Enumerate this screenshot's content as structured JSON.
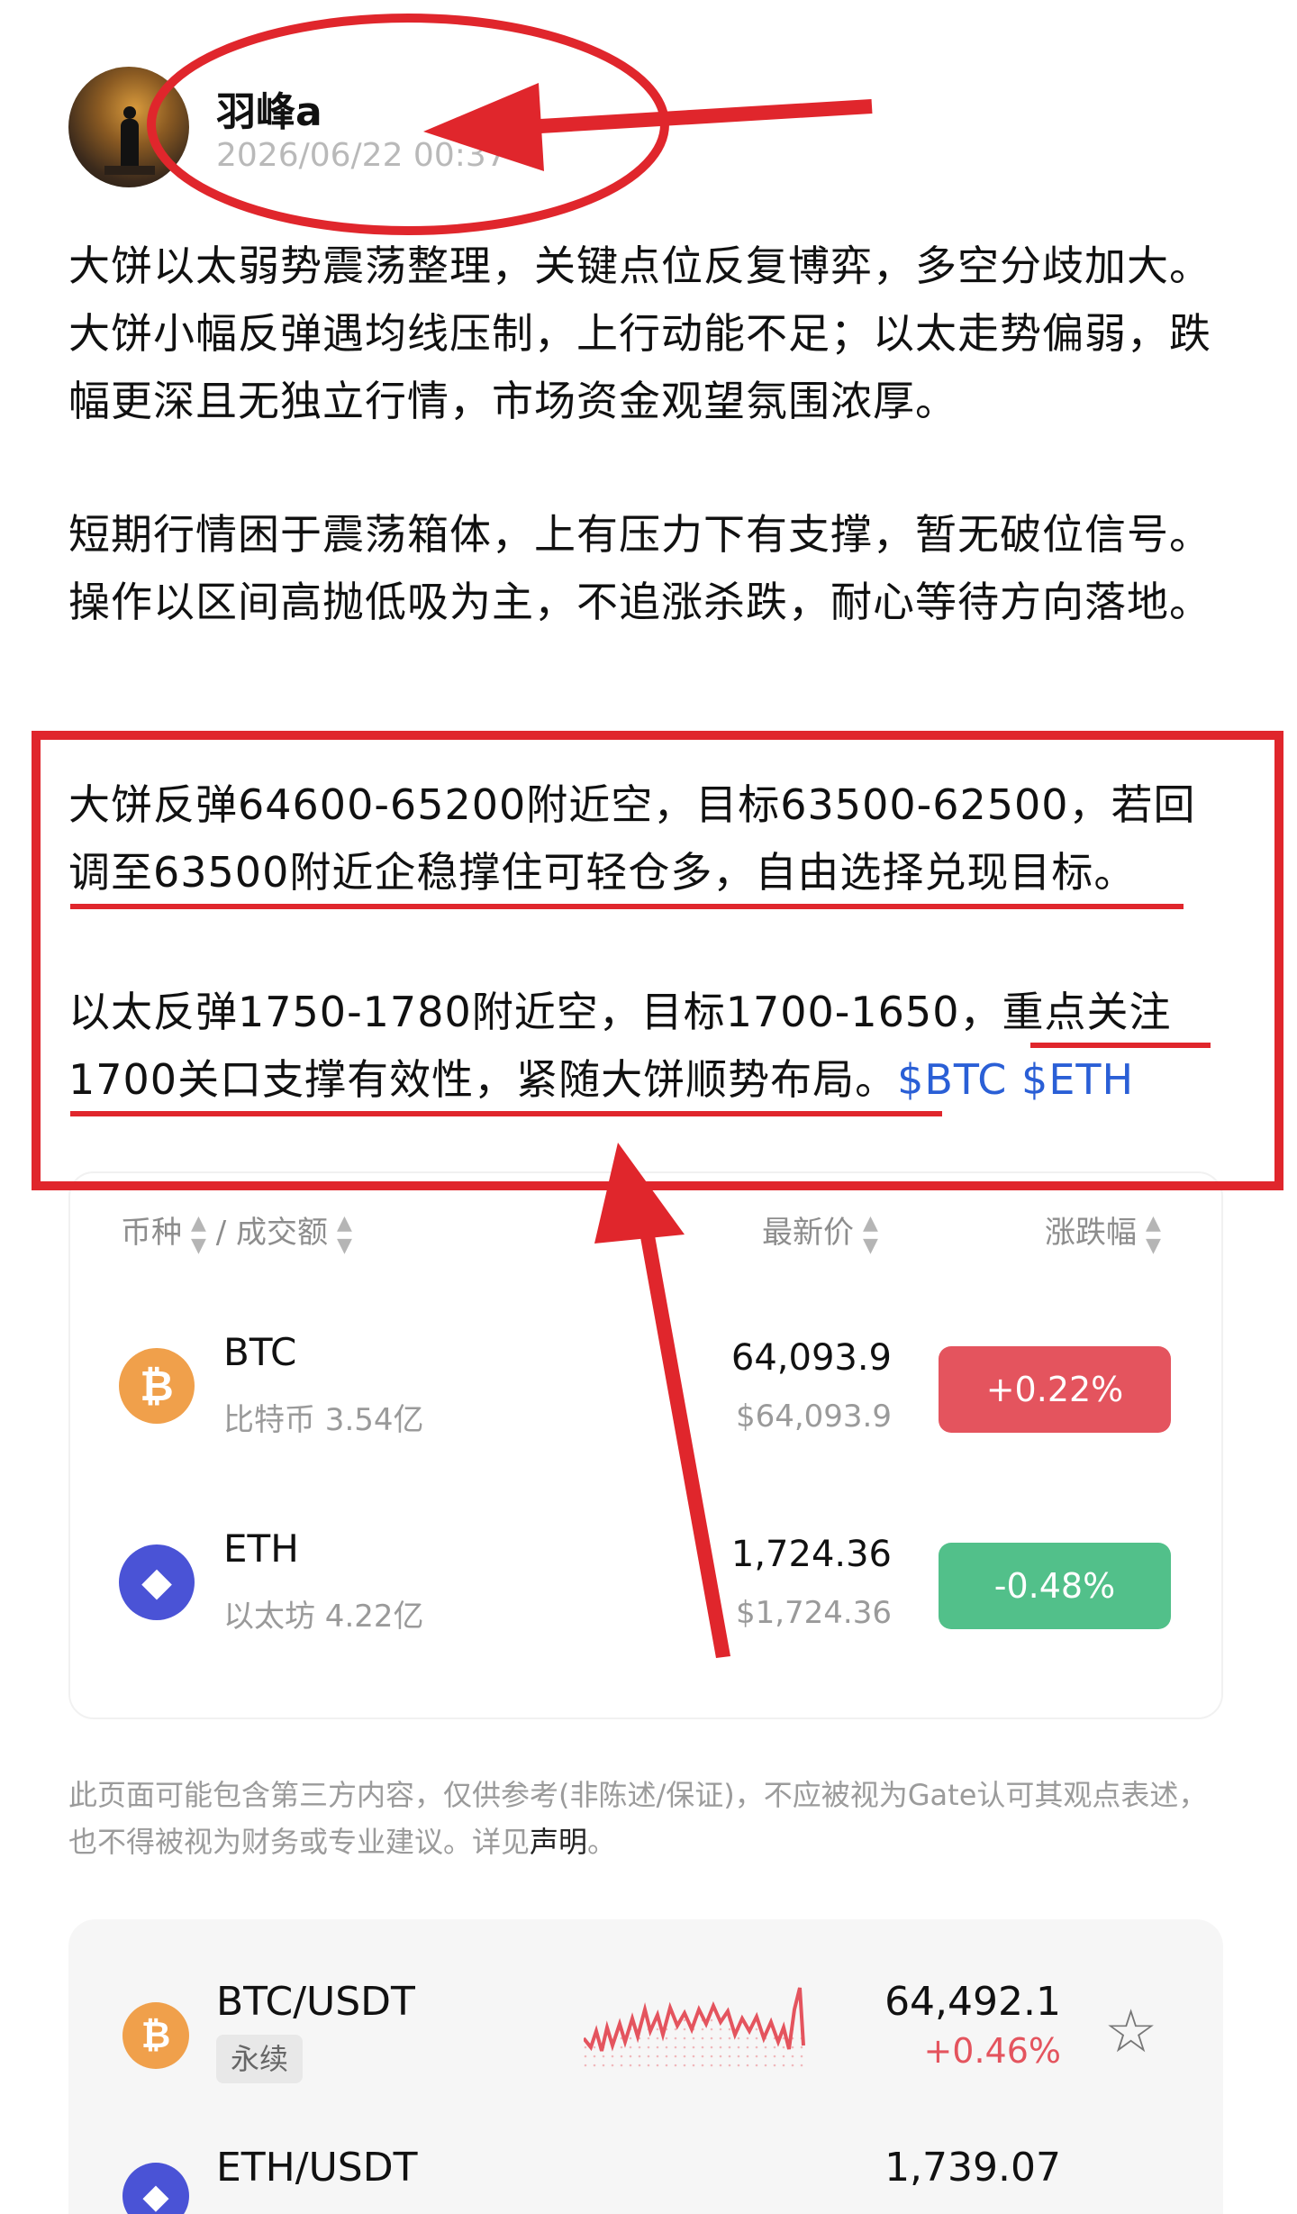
{
  "post": {
    "username": "羽峰a",
    "timestamp": "2026/06/22 00:37",
    "paragraph1": "大饼以太弱势震荡整理，关键点位反复博弈，多空分歧加大。大饼小幅反弹遇均线压制，上行动能不足；以太走势偏弱，跌幅更深且无独立行情，市场资金观望氛围浓厚。",
    "paragraph2": "短期行情困于震荡箱体，上有压力下有支撑，暂无破位信号。操作以区间高抛低吸为主，不追涨杀跌，耐心等待方向落地。",
    "paragraph3": "大饼反弹64600-65200附近空，目标63500-62500，若回调至63500附近企稳撑住可轻仓多，自由选择兑现目标。",
    "paragraph4": "以太反弹1750-1780附近空，目标1700-1650，重点关注1700关口支撑有效性，紧随大饼顺势布局。",
    "tags": "$BTC $ETH"
  },
  "market_table": {
    "header_coin": "币种",
    "header_sep": "/",
    "header_volume": "成交额",
    "header_price": "最新价",
    "header_change": "涨跌幅",
    "rows": [
      {
        "icon": "btc-icon",
        "glyph": "₿",
        "symbol": "BTC",
        "sub": "比特币 3.54亿",
        "price": "64,093.9",
        "price_usd": "$64,093.9",
        "change": "+0.22%",
        "color": "#e4545e"
      },
      {
        "icon": "eth-icon",
        "glyph": "◆",
        "symbol": "ETH",
        "sub": "以太坊 4.22亿",
        "price": "1,724.36",
        "price_usd": "$1,724.36",
        "change": "-0.48%",
        "color": "#52c08a"
      }
    ]
  },
  "disclaimer": {
    "text": "此页面可能包含第三方内容，仅供参考(非陈述/保证)，不应被视为Gate认可其观点表述，也不得被视为财务或专业建议。详见",
    "link": "声明",
    "end": "。"
  },
  "tickers": [
    {
      "pair": "BTC/USDT",
      "badge": "永续",
      "price": "64,492.1",
      "change": "+0.46%"
    },
    {
      "pair": "ETH/USDT",
      "price": "1,739.07"
    }
  ],
  "colors": {
    "annotation_red": "#e0262c",
    "up": "#e4545e",
    "down": "#52c08a",
    "tag_blue": "#2a5fd6"
  }
}
